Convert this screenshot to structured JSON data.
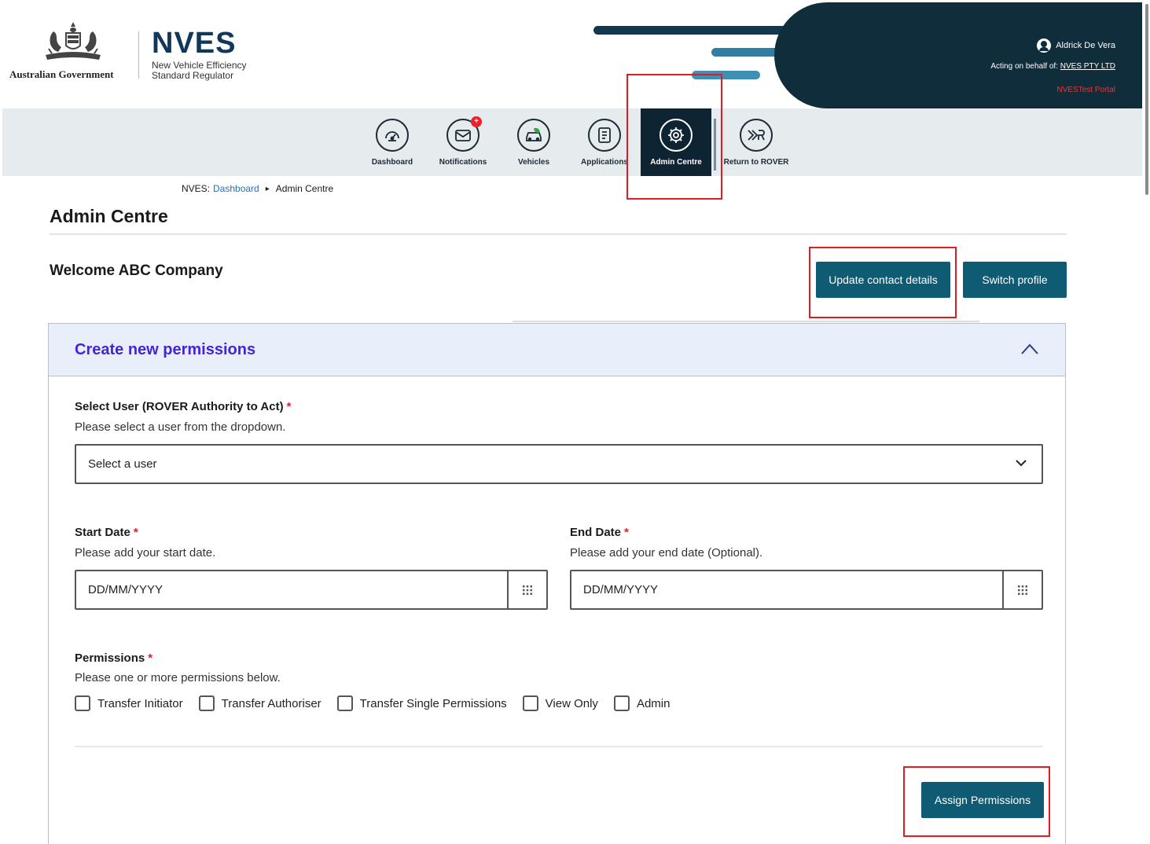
{
  "header": {
    "gov_name": "Australian Government",
    "brand_name": "NVES",
    "brand_sub_line1": "New Vehicle Efficiency",
    "brand_sub_line2": "Standard Regulator",
    "user_name": "Aldrick De Vera",
    "acting_prefix": "Acting on behalf of:",
    "acting_org": "NVES PTY LTD",
    "portal_label": "NVESTest Portal"
  },
  "nav": {
    "items": [
      {
        "label": "Dashboard",
        "icon": "speedometer-icon"
      },
      {
        "label": "Notifications",
        "icon": "envelope-icon",
        "badge": "+"
      },
      {
        "label": "Vehicles",
        "icon": "car-icon"
      },
      {
        "label": "Applications",
        "icon": "document-icon"
      },
      {
        "label": "Admin Centre",
        "icon": "gear-icon",
        "active": true
      },
      {
        "label": "Return to ROVER",
        "icon": "rover-icon"
      }
    ]
  },
  "breadcrumb": {
    "root": "NVES:",
    "link": "Dashboard",
    "current": "Admin Centre"
  },
  "page": {
    "title": "Admin Centre",
    "welcome": "Welcome ABC Company",
    "update_btn": "Update contact details",
    "switch_btn": "Switch profile"
  },
  "form": {
    "card_title": "Create new permissions",
    "user_label": "Select User (ROVER Authority to Act)",
    "user_hint": "Please select a user from the dropdown.",
    "user_placeholder": "Select a user",
    "start_label": "Start Date",
    "start_hint": "Please add your start date.",
    "start_placeholder": "DD/MM/YYYY",
    "end_label": "End Date",
    "end_hint": "Please add your end date (Optional).",
    "end_placeholder": "DD/MM/YYYY",
    "perm_label": "Permissions",
    "perm_hint": "Please one or more permissions below.",
    "required_mark": "*",
    "permissions": [
      "Transfer Initiator",
      "Transfer Authoriser",
      "Transfer Single Permissions",
      "View Only",
      "Admin"
    ],
    "assign_btn": "Assign Permissions"
  },
  "colors": {
    "primary": "#0f5b73",
    "dark": "#0f2d3b",
    "accent_title": "#4424d6",
    "required": "#d4252c",
    "highlight": "#e01b22"
  }
}
